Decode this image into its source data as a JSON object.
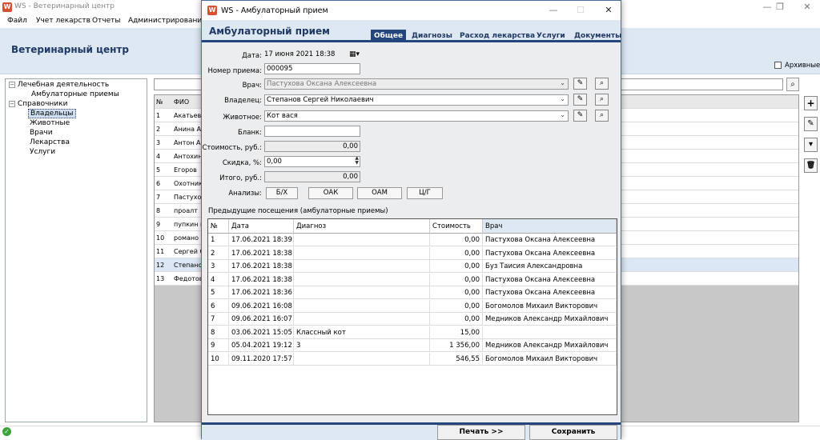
{
  "main_window": {
    "title": "WS - Ветеринарный центр",
    "logo": "W",
    "menu": [
      "Файл",
      "Учет лекарств",
      "Отчеты",
      "Администрирование"
    ],
    "app_title": "Ветеринарный центр",
    "archive_label": "Архивные",
    "tree": {
      "root1": "Лечебная деятельность",
      "root1_children": [
        "Амбулаторные приемы"
      ],
      "root2": "Справочники",
      "root2_children": [
        "Владельцы",
        "Животные",
        "Врачи",
        "Лекарства",
        "Услуги"
      ]
    },
    "grid": {
      "headers": [
        "№",
        "ФИО"
      ],
      "rows": [
        {
          "n": "1",
          "name": "Акатьевы"
        },
        {
          "n": "2",
          "name": "Анина А"
        },
        {
          "n": "3",
          "name": "Антон А"
        },
        {
          "n": "4",
          "name": "Антохин"
        },
        {
          "n": "5",
          "name": "Егоров"
        },
        {
          "n": "6",
          "name": "Охотник"
        },
        {
          "n": "7",
          "name": "Пастухо"
        },
        {
          "n": "8",
          "name": "проалт"
        },
        {
          "n": "9",
          "name": "пупкин и"
        },
        {
          "n": "10",
          "name": "романо"
        },
        {
          "n": "11",
          "name": "Сергей С"
        },
        {
          "n": "12",
          "name": "Степано"
        },
        {
          "n": "13",
          "name": "Федотов"
        }
      ]
    },
    "toolbar": {
      "add": "+",
      "edit": "✎",
      "archive": "▾",
      "delete": "🗑"
    },
    "icons": {
      "search": "search-icon",
      "status": "check-icon"
    }
  },
  "modal": {
    "title": "WS - Амбулаторный прием",
    "heading": "Амбулаторный прием",
    "tabs": [
      "Общее",
      "Диагнозы",
      "Расход лекарства",
      "Услуги",
      "Документы"
    ],
    "active_tab": "Общее",
    "fields": {
      "date_label": "Дата:",
      "date_value": "17    июня    2021 18:38",
      "number_label": "Номер приема:",
      "number_value": "000095",
      "doctor_label": "Врач:",
      "doctor_value": "Пастухова  Оксана Алексеевна",
      "owner_label": "Владелец:",
      "owner_value": "Степанов Сергей  Николаевич",
      "animal_label": "Животное:",
      "animal_value": "Кот вася",
      "blank_label": "Бланк:",
      "blank_value": "",
      "cost_label": "Стоимость, руб.:",
      "cost_value": "0,00",
      "discount_label": "Скидка, %:",
      "discount_value": "0,00",
      "total_label": "Итого, руб.:",
      "total_value": "0,00",
      "analyses_label": "Анализы:"
    },
    "analysis_buttons": [
      "Б/Х",
      "ОАК",
      "ОАМ",
      "Ц/Г"
    ],
    "visits_label": "Предыдущие посещения (амбулаторные приемы)",
    "visits": {
      "headers": [
        "№",
        "Дата",
        "Диагноз",
        "Стоимость",
        "Врач"
      ],
      "rows": [
        [
          "1",
          "17.06.2021 18:39",
          "",
          "0,00",
          "Пастухова  Оксана Алексеевна"
        ],
        [
          "2",
          "17.06.2021 18:38",
          "",
          "0,00",
          "Пастухова  Оксана Алексеевна"
        ],
        [
          "3",
          "17.06.2021 18:38",
          "",
          "0,00",
          "Буз  Таисия  Александровна"
        ],
        [
          "4",
          "17.06.2021 18:38",
          "",
          "0,00",
          "Пастухова  Оксана Алексеевна"
        ],
        [
          "5",
          "17.06.2021 18:36",
          "",
          "0,00",
          "Пастухова  Оксана Алексеевна"
        ],
        [
          "6",
          "09.06.2021 16:08",
          "",
          "0,00",
          "Богомолов Михаил Викторович"
        ],
        [
          "7",
          "09.06.2021 16:07",
          "",
          "0,00",
          "Медников  Александр  Михайлович"
        ],
        [
          "8",
          "03.06.2021 15:05",
          "Классный кот",
          "15,00",
          ""
        ],
        [
          "9",
          "05.04.2021 19:12",
          "3",
          "1 356,00",
          "Медников  Александр  Михайлович"
        ],
        [
          "10",
          "09.11.2020 17:57",
          "",
          "546,55",
          "Богомолов Михаил Викторович"
        ]
      ]
    },
    "footer": {
      "print": "Печать   >>",
      "save": "Сохранить"
    }
  }
}
